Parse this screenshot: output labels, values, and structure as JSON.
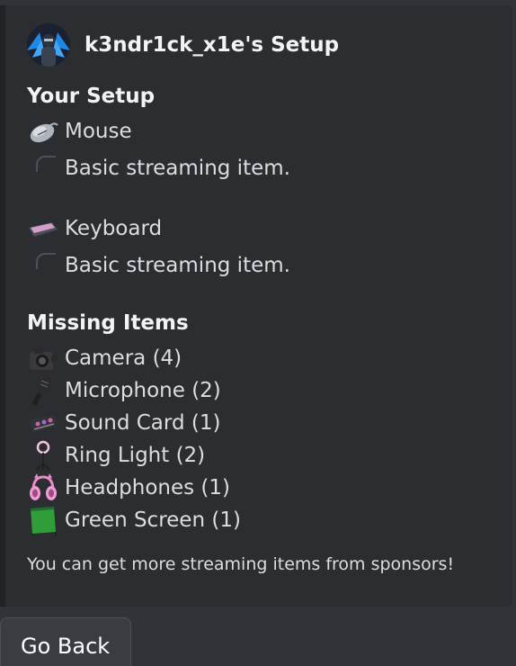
{
  "embed": {
    "author_name": "k3ndr1ck_x1e's Setup",
    "your_setup_title": "Your Setup",
    "your_setup": [
      {
        "label": "Mouse",
        "description": "Basic streaming item.",
        "icon": "mouse-icon"
      },
      {
        "label": "Keyboard",
        "description": "Basic streaming item.",
        "icon": "keyboard-icon"
      }
    ],
    "missing_title": "Missing Items",
    "missing_items": [
      {
        "label": "Camera (4)",
        "icon": "camera-icon"
      },
      {
        "label": "Microphone (2)",
        "icon": "microphone-icon"
      },
      {
        "label": "Sound Card (1)",
        "icon": "sound-card-icon"
      },
      {
        "label": "Ring Light (2)",
        "icon": "ring-light-icon"
      },
      {
        "label": "Headphones (1)",
        "icon": "headphones-icon"
      },
      {
        "label": "Green Screen (1)",
        "icon": "green-screen-icon"
      }
    ],
    "footer": "You can get more streaming items from sponsors!"
  },
  "buttons": {
    "go_back": "Go Back"
  },
  "colors": {
    "background": "#313338",
    "embed_background": "#2b2d31",
    "embed_border": "#202225",
    "text": "#dbdee1",
    "heading": "#f2f3f5"
  }
}
